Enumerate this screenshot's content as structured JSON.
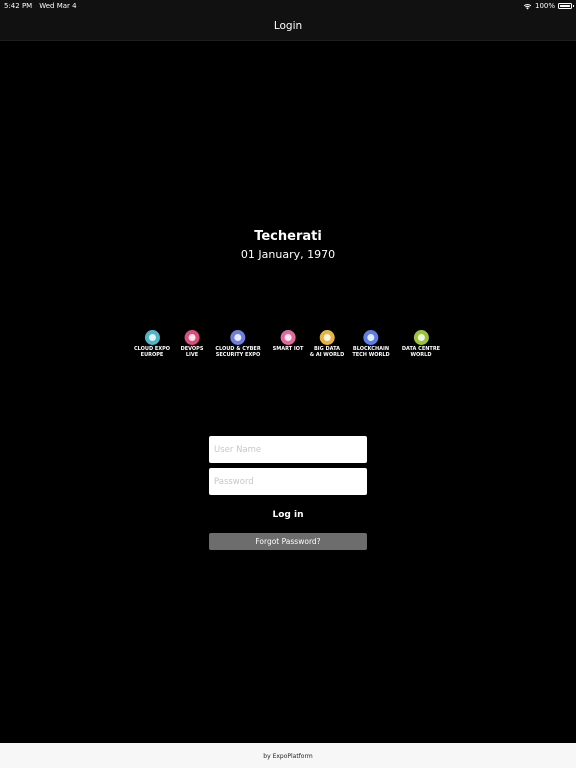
{
  "status_bar": {
    "time": "5:42 PM",
    "date": "Wed Mar 4",
    "battery": "100%"
  },
  "nav": {
    "title": "Login"
  },
  "event": {
    "name": "Techerati",
    "date": "01 January, 1970"
  },
  "logos": [
    {
      "line1": "CLOUD EXPO",
      "line2": "EUROPE",
      "color": "#4fb6c9"
    },
    {
      "line1": "DEVOPS",
      "line2": "LIVE",
      "color": "#d94e7c"
    },
    {
      "line1": "CLOUD & CYBER",
      "line2": "SECURITY EXPO",
      "color": "#6f7fe0"
    },
    {
      "line1": "SMART IOT",
      "line2": "",
      "color": "#e16aa0"
    },
    {
      "line1": "BIG DATA",
      "line2": "& AI WORLD",
      "color": "#e8b340"
    },
    {
      "line1": "BLOCKCHAIN",
      "line2": "TECH WORLD",
      "color": "#5b7fe8"
    },
    {
      "line1": "DATA CENTRE",
      "line2": "WORLD",
      "color": "#9bc43c"
    }
  ],
  "form": {
    "username_placeholder": "User Name",
    "username_value": "",
    "password_placeholder": "Password",
    "password_value": "",
    "login_label": "Log in",
    "forgot_label": "Forgot Password?"
  },
  "footer": {
    "text": "by ExpoPlatform"
  }
}
